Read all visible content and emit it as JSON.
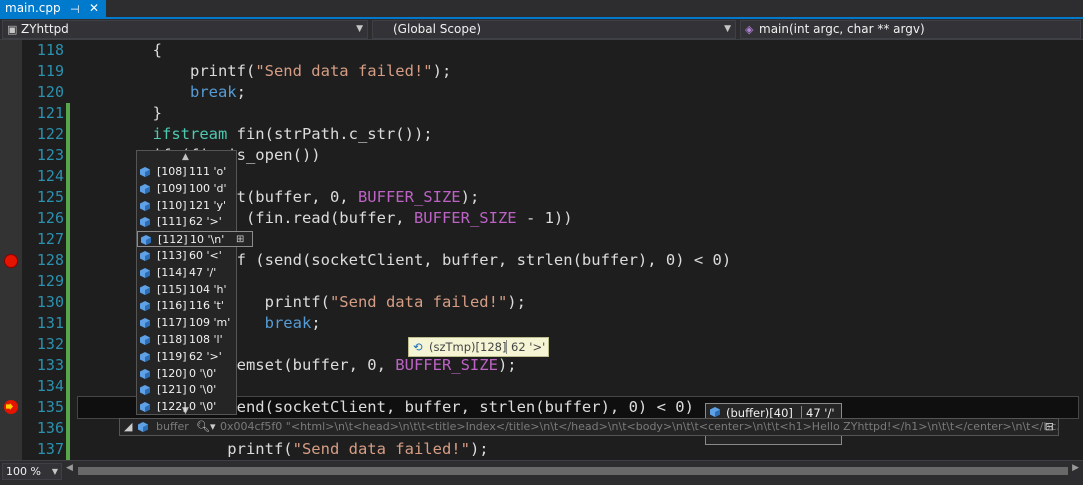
{
  "tab": {
    "label": "main.cpp",
    "pin": "⊣",
    "close": "✕"
  },
  "nav": {
    "project": "ZYhttpd",
    "scope": "(Global Scope)",
    "function": "main(int argc, char ** argv)"
  },
  "lines": [
    {
      "num": "118",
      "html": "        {"
    },
    {
      "num": "119",
      "html": "            printf(<span class='str'>\"Send data failed!\"</span>);"
    },
    {
      "num": "120",
      "html": "            <span class='kw'>break</span>;"
    },
    {
      "num": "121",
      "html": "        }"
    },
    {
      "num": "122",
      "html": "        <span class='typ'>ifstream</span> fin(strPath.c_str());"
    },
    {
      "num": "123",
      "html": "        if (fin.is_open())"
    },
    {
      "num": "124",
      "html": "        {"
    },
    {
      "num": "125",
      "html": "            memset(buffer, 0, <span class='mac'>BUFFER_SIZE</span>);"
    },
    {
      "num": "126",
      "html": "            while (fin.read(buffer, <span class='mac'>BUFFER_SIZE</span> - 1))"
    },
    {
      "num": "127",
      "html": "            {"
    },
    {
      "num": "128",
      "html": "                if (send(socketClient, buffer, strlen(buffer), 0) < 0)"
    },
    {
      "num": "129",
      "html": "                {"
    },
    {
      "num": "130",
      "html": "                    printf(<span class='str'>\"Send data failed!\"</span>);"
    },
    {
      "num": "131",
      "html": "                    <span class='kw'>break</span>;"
    },
    {
      "num": "132",
      "html": "                }"
    },
    {
      "num": "133",
      "html": "                memset(buffer, 0, <span class='mac'>BUFFER_SIZE</span>);"
    },
    {
      "num": "134",
      "html": "            }"
    },
    {
      "num": "135",
      "html": "            if (send(socketClient, buffer, strlen(buffer), 0) < 0)"
    },
    {
      "num": "136",
      "html": "            {"
    },
    {
      "num": "137",
      "html": "                printf(<span class='str'>\"Send data failed!\"</span>);"
    }
  ],
  "datatip": {
    "items": [
      {
        "index": "[108]",
        "value": "111 'o'"
      },
      {
        "index": "[109]",
        "value": "100 'd'"
      },
      {
        "index": "[110]",
        "value": "121 'y'"
      },
      {
        "index": "[111]",
        "value": "62 '>'"
      },
      {
        "index": "[112]",
        "value": "10 '\\n'"
      },
      {
        "index": "[113]",
        "value": "60 '<'"
      },
      {
        "index": "[114]",
        "value": "47 '/'"
      },
      {
        "index": "[115]",
        "value": "104 'h'"
      },
      {
        "index": "[116]",
        "value": "116 't'"
      },
      {
        "index": "[117]",
        "value": "109 'm'"
      },
      {
        "index": "[118]",
        "value": "108 'l'"
      },
      {
        "index": "[119]",
        "value": "62 '>'"
      },
      {
        "index": "[120]",
        "value": "0 '\\0'"
      },
      {
        "index": "[121]",
        "value": "0 '\\0'"
      },
      {
        "index": "[122]",
        "value": "0 '\\0'"
      }
    ]
  },
  "tip_sztmp": {
    "expr": "(szTmp)[128]",
    "value": "62 '>'"
  },
  "tip_buffer40": {
    "expr": "(buffer)[40]",
    "value": "47 '/'"
  },
  "longtip": {
    "name": "buffer",
    "value": "0x004cf5f0 \"<html>\\n\\t<head>\\n\\t\\t<title>Index</title>\\n\\t</head>\\n\\t<body>\\n\\t\\t<center>\\n\\t\\t<h1>Hello ZYhttpd!</h1>\\n\\t\\t</center>\\n\\t</bc..."
  },
  "zoom": "100 %",
  "colors": {
    "accent": "#007acc",
    "breakpoint": "#e51400",
    "background": "#1e1e1e"
  }
}
